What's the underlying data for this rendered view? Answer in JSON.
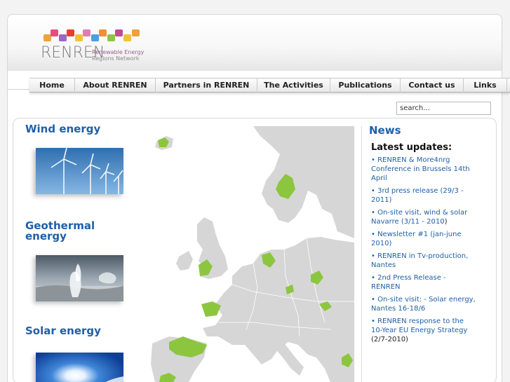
{
  "logo": {
    "wordmark": "RENREN",
    "tagline_1": "Renewable Energy",
    "tagline_2": "Regions Network",
    "tile_colors": [
      "#f0a13c",
      "#e64e78",
      "#9b67c4",
      "#e4402e",
      "#f2c23a",
      "#e07cb5",
      "#4f9fde",
      "#f08f35",
      "#8fc448",
      "#c24a96",
      "#f2c33a"
    ]
  },
  "nav": {
    "items": [
      "Home",
      "About RENREN",
      "Partners in RENREN",
      "The Activities",
      "Publications",
      "Contact us",
      "Links"
    ]
  },
  "search": {
    "value": "search..."
  },
  "sections": {
    "wind": "Wind energy",
    "geo_1": "Geothermal",
    "geo_2": "energy",
    "solar": "Solar energy"
  },
  "news": {
    "title": "News",
    "subtitle": "Latest updates:",
    "items": [
      {
        "text": "• RENREN & More4nrg Conference in Brussels 14th April",
        "suffix": ""
      },
      {
        "text": "• 3rd press release (29/3 - 2011)",
        "suffix": ""
      },
      {
        "text": "• On-site visit, wind & solar Navarre (3/11 - 2010",
        "suffix": ")"
      },
      {
        "text": "• Newsletter #1 (jan-june 2010)",
        "suffix": ""
      },
      {
        "text": "• RENREN in Tv-production, Nantes",
        "suffix": ""
      },
      {
        "text": "• 2nd Press Release - RENREN",
        "suffix": ""
      },
      {
        "text": "• On-site visit: - Solar energy, Nantes 16-18/6",
        "suffix": ""
      },
      {
        "text": "• RENREN response to the 10-Year EU Energy Strategy",
        "suffix": " (2/7-2010)"
      }
    ]
  },
  "colors": {
    "accent": "#1f5fa8",
    "region_highlight": "#8cc63f",
    "land": "#d6d6d6",
    "sea": "#ffffff"
  }
}
